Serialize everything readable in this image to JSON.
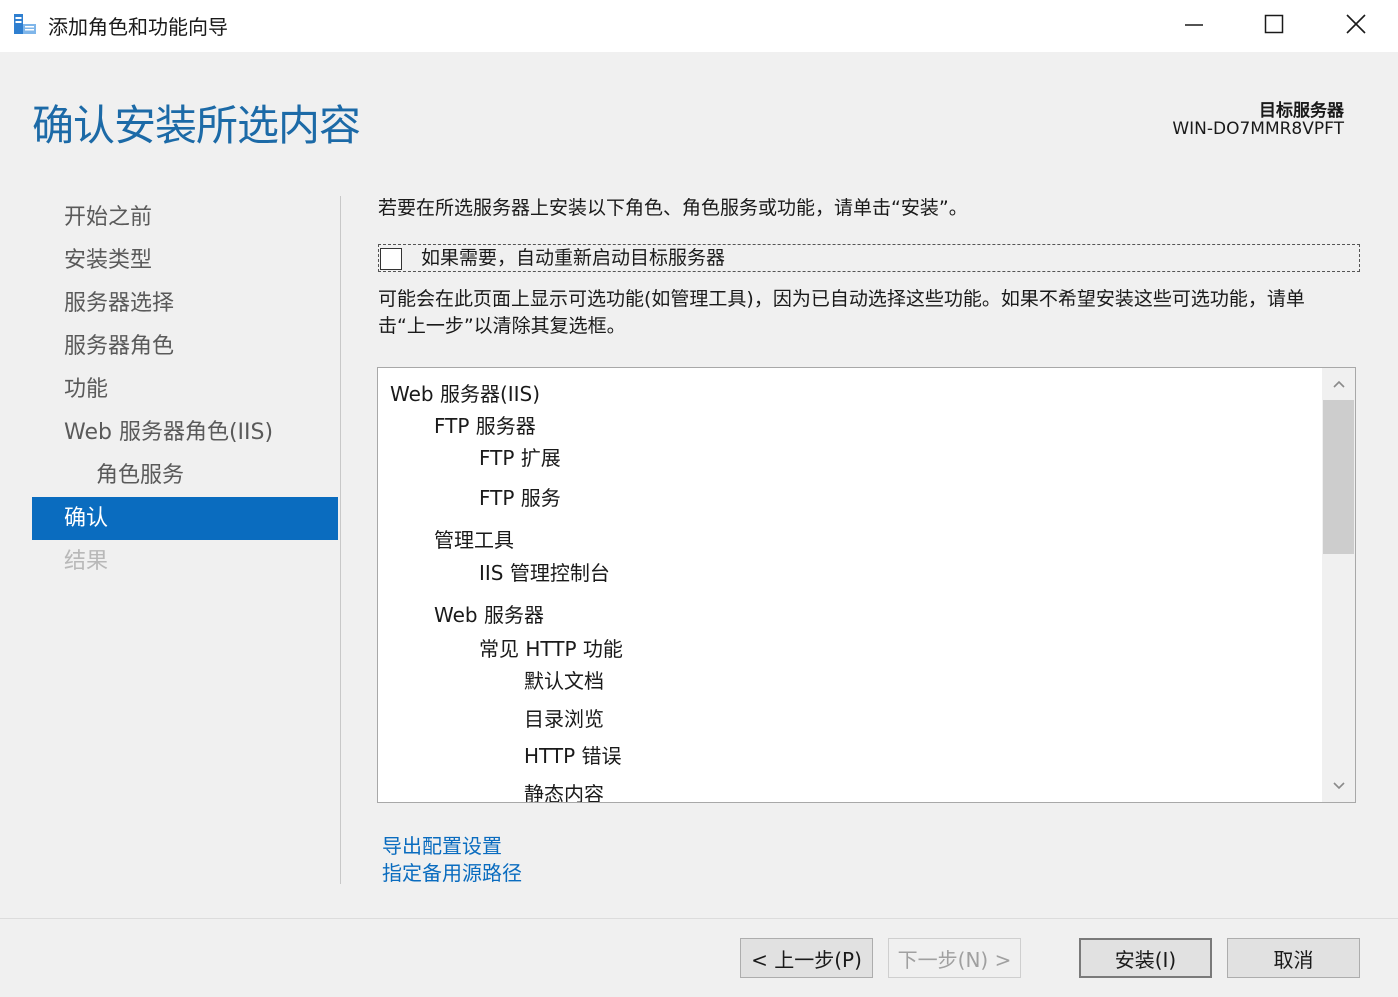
{
  "window": {
    "title": "添加角色和功能向导",
    "icon": "server-manager-icon"
  },
  "header": {
    "page_title": "确认安装所选内容",
    "target_label": "目标服务器",
    "target_value": "WIN-DO7MMR8VPFT"
  },
  "nav": {
    "items": [
      {
        "label": "开始之前",
        "state": "normal"
      },
      {
        "label": "安装类型",
        "state": "normal"
      },
      {
        "label": "服务器选择",
        "state": "normal"
      },
      {
        "label": "服务器角色",
        "state": "normal"
      },
      {
        "label": "功能",
        "state": "normal"
      },
      {
        "label": "Web 服务器角色(IIS)",
        "state": "normal"
      },
      {
        "label": "角色服务",
        "state": "normal",
        "sub": true
      },
      {
        "label": "确认",
        "state": "active"
      },
      {
        "label": "结果",
        "state": "disabled"
      }
    ]
  },
  "content": {
    "instruction": "若要在所选服务器上安装以下角色、角色服务或功能，请单击“安装”。",
    "restart_checkbox": {
      "label": "如果需要，自动重新启动目标服务器",
      "checked": false
    },
    "note": "可能会在此页面上显示可选功能(如管理工具)，因为已自动选择这些功能。如果不希望安装这些可选功能，请单击“上一步”以清除其复选框。",
    "features": [
      {
        "text": "Web 服务器(IIS)",
        "level": 0
      },
      {
        "text": "FTP 服务器",
        "level": 1
      },
      {
        "text": "FTP 扩展",
        "level": 2
      },
      {
        "text": "FTP 服务",
        "level": 2
      },
      {
        "text": "管理工具",
        "level": 1
      },
      {
        "text": "IIS 管理控制台",
        "level": 2
      },
      {
        "text": "Web 服务器",
        "level": 1
      },
      {
        "text": "常见 HTTP 功能",
        "level": 2
      },
      {
        "text": "默认文档",
        "level": 3
      },
      {
        "text": "目录浏览",
        "level": 3
      },
      {
        "text": "HTTP 错误",
        "level": 3
      },
      {
        "text": "静态内容",
        "level": 3
      }
    ],
    "links": {
      "export": "导出配置设置",
      "alt_source": "指定备用源路径"
    }
  },
  "buttons": {
    "previous": "< 上一步(P)",
    "next": "下一步(N) >",
    "install": "安装(I)",
    "cancel": "取消"
  },
  "colors": {
    "accent": "#0a6cbf",
    "title_blue": "#1c6aa7"
  }
}
